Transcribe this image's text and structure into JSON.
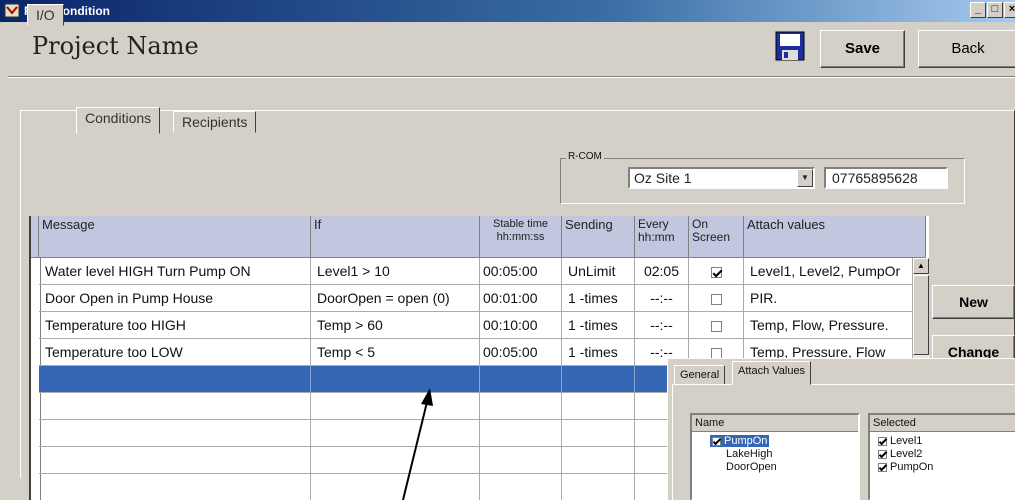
{
  "window": {
    "title": "FormCondition",
    "controls": [
      "_",
      "□",
      "×"
    ]
  },
  "header": {
    "project_title": "Project Name",
    "save_label": "Save",
    "back_label": "Back"
  },
  "tabs": [
    {
      "label": "I/O"
    },
    {
      "label": "Conditions"
    },
    {
      "label": "Recipients"
    }
  ],
  "rcom": {
    "label": "R-COM",
    "site": "Oz Site 1",
    "phone": "07765895628"
  },
  "grid": {
    "headers": {
      "message": "Message",
      "if": "If",
      "stable": "Stable time hh:mm:ss",
      "sending": "Sending",
      "every": "Every hh:mm",
      "onscreen": "On Screen",
      "attach": "Attach values"
    },
    "rows": [
      {
        "message": "Water level HIGH Turn Pump ON",
        "if": "Level1 > 10",
        "stable": "00:05:00",
        "sending": "UnLimit",
        "every": "02:05",
        "onscreen": true,
        "attach": "Level1, Level2, PumpOr"
      },
      {
        "message": "Door Open in Pump House",
        "if": "DoorOpen = open (0)",
        "stable": "00:01:00",
        "sending": "1 -times",
        "every": "--:--",
        "onscreen": false,
        "attach": "PIR."
      },
      {
        "message": "Temperature too HIGH",
        "if": "Temp > 60",
        "stable": "00:10:00",
        "sending": "1 -times",
        "every": "--:--",
        "onscreen": false,
        "attach": "Temp, Flow, Pressure."
      },
      {
        "message": "Temperature too LOW",
        "if": "Temp < 5",
        "stable": "00:05:00",
        "sending": "1 -times",
        "every": "--:--",
        "onscreen": false,
        "attach": "Temp, Pressure, Flow"
      }
    ]
  },
  "buttons": {
    "new_label": "New",
    "change_label": "Change"
  },
  "popup": {
    "tabs": [
      {
        "label": "General"
      },
      {
        "label": "Attach Values"
      }
    ],
    "name_header": "Name",
    "selected_header": "Selected",
    "names": [
      {
        "label": "PumpOn",
        "checked": true,
        "selected": true
      },
      {
        "label": "LakeHigh",
        "checked": false,
        "selected": false
      },
      {
        "label": "DoorOpen",
        "checked": false,
        "selected": false
      }
    ],
    "selected": [
      {
        "label": "Level1",
        "checked": true
      },
      {
        "label": "Level2",
        "checked": true
      },
      {
        "label": "PumpOn",
        "checked": true
      }
    ]
  },
  "colors": {
    "selection": "#3565b5",
    "header_bg": "#c0c7de",
    "face": "#d4d0c8"
  }
}
